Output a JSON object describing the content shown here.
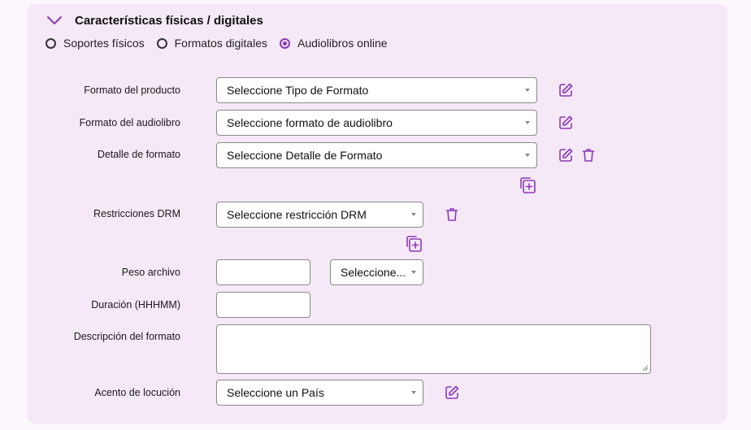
{
  "section": {
    "title": "Características físicas / digitales"
  },
  "radios": [
    {
      "label": "Soportes físicos",
      "checked": false
    },
    {
      "label": "Formatos digitales",
      "checked": false
    },
    {
      "label": "Audiolibros online",
      "checked": true
    }
  ],
  "fields": {
    "formato_producto": {
      "label": "Formato del producto",
      "value": "Seleccione Tipo de Formato"
    },
    "formato_audiolibro": {
      "label": "Formato del audiolibro",
      "value": "Seleccione formato de audiolibro"
    },
    "detalle_formato": {
      "label": "Detalle de formato",
      "value": "Seleccione Detalle de Formato"
    },
    "restricciones_drm": {
      "label": "Restricciones DRM",
      "value": "Seleccione restricción DRM"
    },
    "peso_archivo": {
      "label": "Peso archivo",
      "value": "",
      "unit_value": "Seleccione..."
    },
    "duracion": {
      "label": "Duración (HHHMM)",
      "value": ""
    },
    "descripcion_formato": {
      "label": "Descripción del formato",
      "value": ""
    },
    "acento_locucion": {
      "label": "Acento de locución",
      "value": "Seleccione un País"
    }
  },
  "colors": {
    "accent": "#8a3ab9",
    "panel": "#f5e8f7",
    "page": "#fbf7fc"
  }
}
